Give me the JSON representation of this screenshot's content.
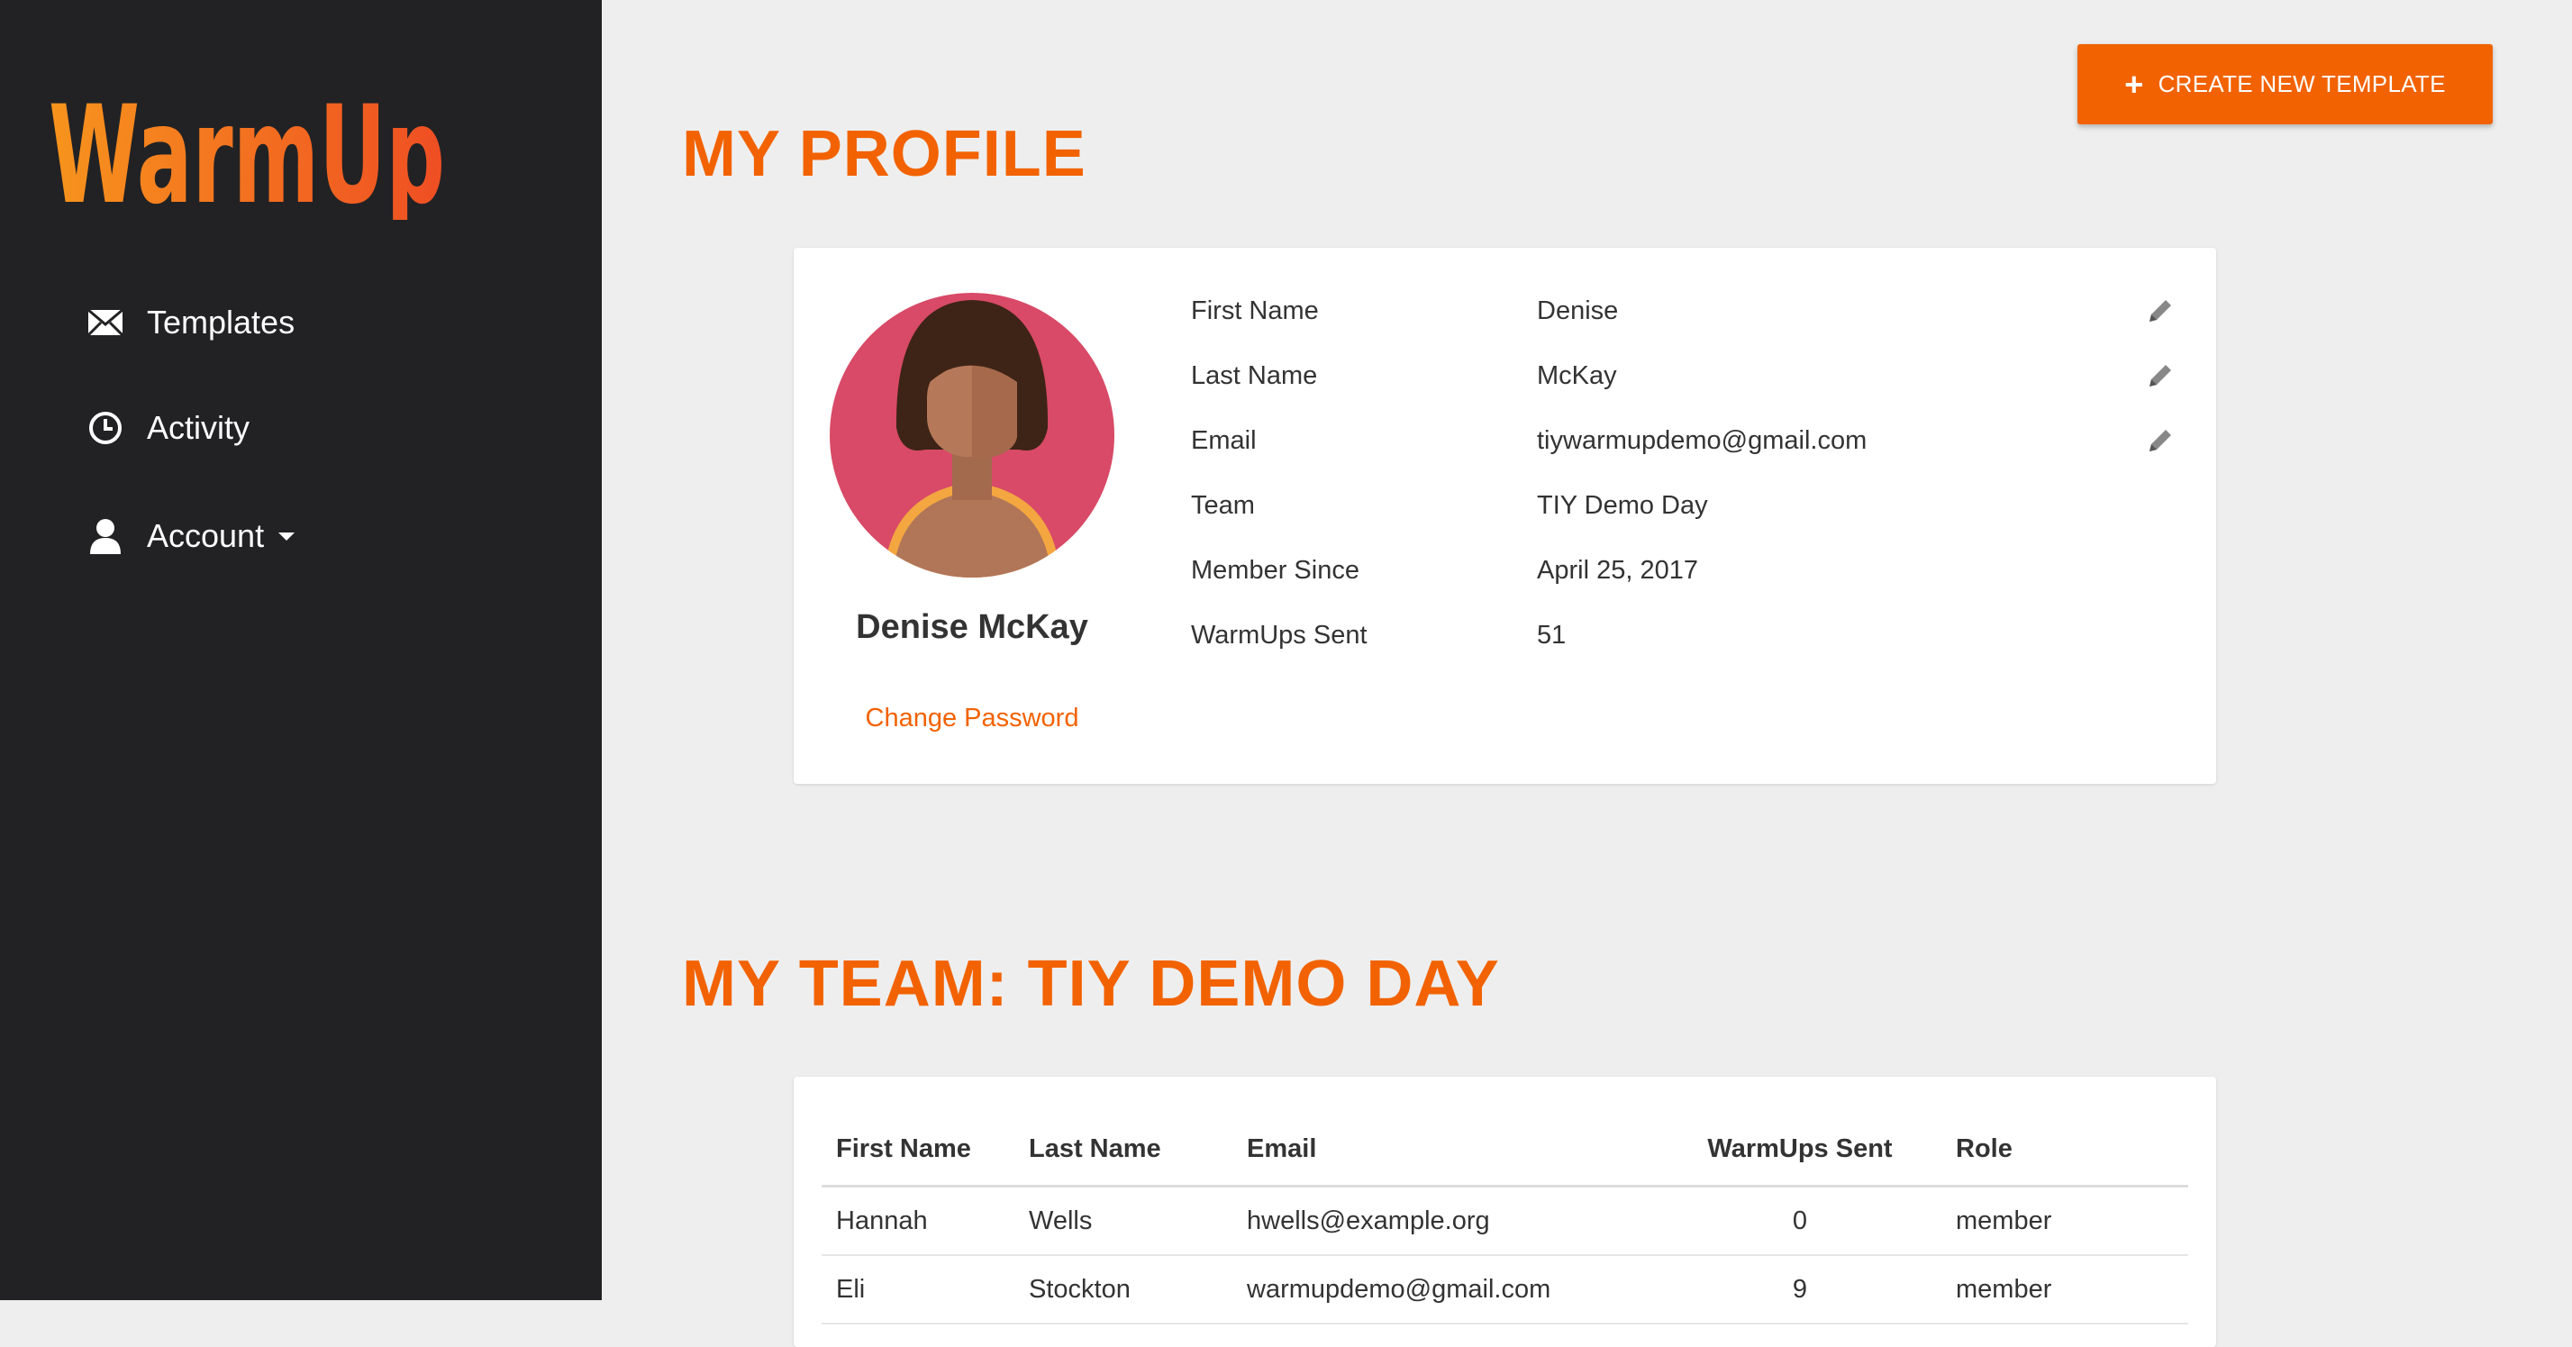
{
  "app": {
    "logo_text": "WarmUp"
  },
  "sidebar": {
    "items": [
      {
        "label": "Templates",
        "icon": "envelope-icon"
      },
      {
        "label": "Activity",
        "icon": "clock-icon"
      },
      {
        "label": "Account",
        "icon": "user-icon"
      }
    ]
  },
  "header": {
    "create_label": "CREATE NEW TEMPLATE"
  },
  "profile": {
    "title": "MY PROFILE",
    "full_name": "Denise McKay",
    "change_password": "Change Password",
    "fields": [
      {
        "label": "First Name",
        "value": "Denise",
        "editable": true
      },
      {
        "label": "Last Name",
        "value": "McKay",
        "editable": true
      },
      {
        "label": "Email",
        "value": "tiywarmupdemo@gmail.com",
        "editable": true
      },
      {
        "label": "Team",
        "value": "TIY Demo Day",
        "editable": false
      },
      {
        "label": "Member Since",
        "value": "April 25, 2017",
        "editable": false
      },
      {
        "label": "WarmUps Sent",
        "value": "51",
        "editable": false
      }
    ]
  },
  "team": {
    "title": "MY TEAM: TIY DEMO DAY",
    "columns": [
      "First Name",
      "Last Name",
      "Email",
      "WarmUps Sent",
      "Role"
    ],
    "rows": [
      [
        "Hannah",
        "Wells",
        "hwells@example.org",
        "0",
        "member"
      ],
      [
        "Eli",
        "Stockton",
        "warmupdemo@gmail.com",
        "9",
        "member"
      ]
    ]
  },
  "colors": {
    "accent": "#f26200",
    "sidebar": "#222224",
    "background": "#eeeeee"
  }
}
